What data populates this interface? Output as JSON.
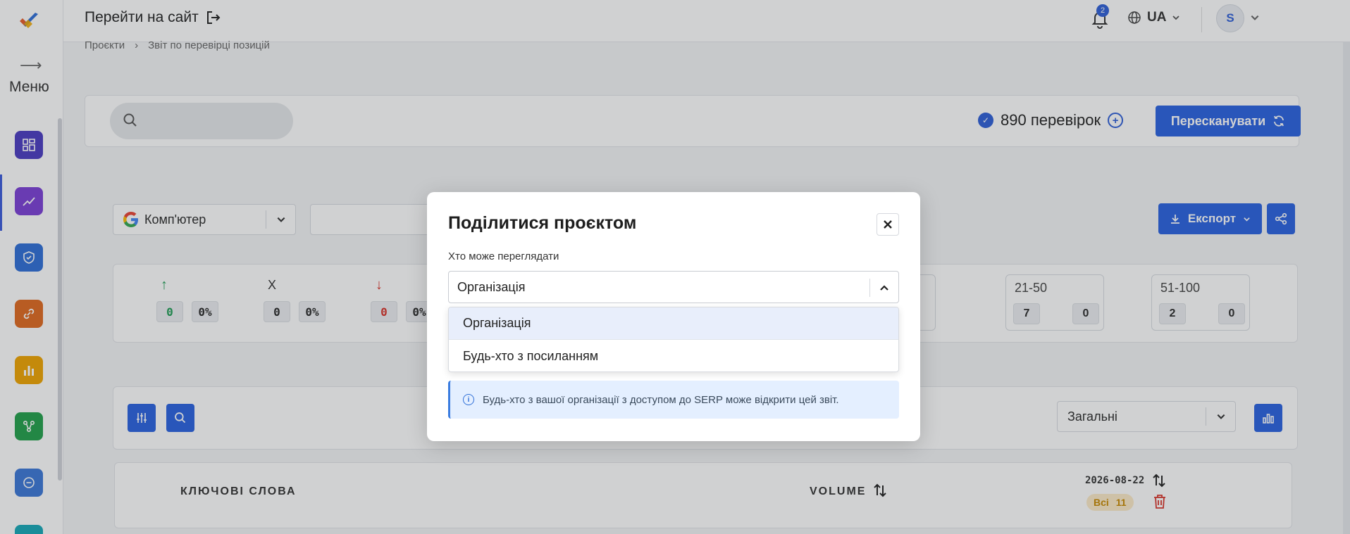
{
  "sidebar": {
    "menu_label": "Меню",
    "menu_arrow": "⟶",
    "icons": [
      {
        "name": "dashboard-icon",
        "color": "#4b3bc2"
      },
      {
        "name": "trending-icon",
        "color": "#7b3fd6"
      },
      {
        "name": "shield-icon",
        "color": "#2f6fd8"
      },
      {
        "name": "link-icon",
        "color": "#e0691f"
      },
      {
        "name": "bar-chart-icon",
        "color": "#f0a500"
      },
      {
        "name": "network-icon",
        "color": "#22a04b"
      },
      {
        "name": "minus-circle-icon",
        "color": "#3b78d8"
      },
      {
        "name": "teal-icon",
        "color": "#17a8b8"
      }
    ]
  },
  "topbar": {
    "goto_site": "Перейти на сайт",
    "notifications_count": "2",
    "language": "UA",
    "avatar_initial": "S"
  },
  "breadcrumb": {
    "items": [
      "Проєкти",
      "Звіт по перевірці позицій"
    ],
    "separator": "›"
  },
  "toolbar": {
    "checks_label": "890 перевірок",
    "rescan_label": "Пересканувати"
  },
  "filters": {
    "device": "Комп'ютер",
    "export_label": "Експорт"
  },
  "stats": {
    "up": {
      "symbol": "↑",
      "count": "0",
      "percent": "0%"
    },
    "neutral": {
      "symbol": "X",
      "count": "0",
      "percent": "0%"
    },
    "down": {
      "symbol": "↓",
      "count": "0",
      "percent": "0%"
    },
    "partial_hidden_value": "0",
    "ranges": [
      {
        "label": "21-50",
        "a": "7",
        "b": "0"
      },
      {
        "label": "51-100",
        "a": "2",
        "b": "0"
      }
    ]
  },
  "table": {
    "view_select": "Загальні",
    "col_keywords": "КЛЮЧОВІ СЛОВА",
    "col_volume": "VOLUME",
    "col_date": "2026-08-22",
    "all_badge": "Всі",
    "all_count": "11"
  },
  "modal": {
    "title": "Поділитися проєктом",
    "field_label": "Хто може переглядати",
    "selected_value": "Організація",
    "options": [
      "Організація",
      "Будь-хто з посиланням"
    ],
    "info_text": "Будь-хто з вашої організації з доступом до SERP може відкрити цей звіт."
  },
  "colors": {
    "primary": "#2962e0",
    "up": "#1f9d55",
    "down": "#d9342b",
    "info_bg": "#e4efff"
  }
}
